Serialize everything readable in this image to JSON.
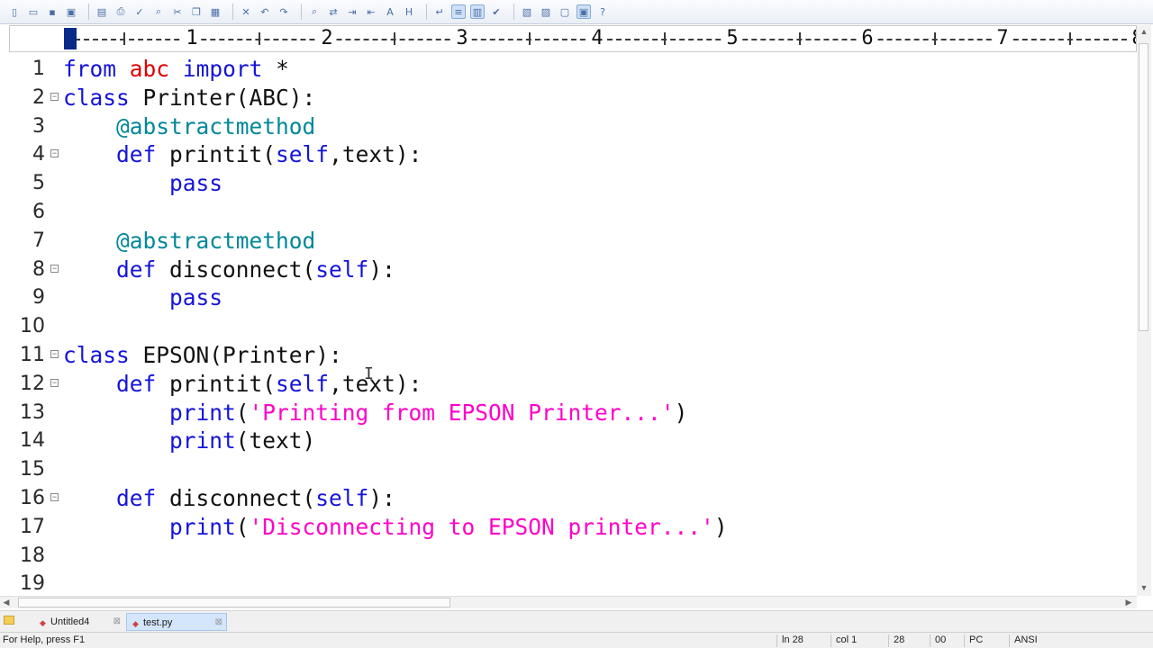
{
  "toolbar": {
    "icons": [
      "new-file-icon",
      "open-folder-icon",
      "save-icon",
      "save-all-icon",
      "print-preview-icon",
      "print-icon",
      "spell-check-icon",
      "find-icon",
      "cut-icon",
      "copy-icon",
      "paste-icon",
      "delete-icon",
      "undo-icon",
      "redo-icon",
      "search-icon",
      "replace-icon",
      "goto-icon",
      "indent-icon",
      "font-a-icon",
      "hex-icon",
      "word-wrap-icon",
      "line-number-icon",
      "code-view-icon",
      "check-icon",
      "panel-left-icon",
      "panel-right-icon",
      "window-icon",
      "fullscreen-icon",
      "help-icon"
    ]
  },
  "ruler": {
    "numbers": [
      "1",
      "2",
      "3",
      "4",
      "5",
      "6",
      "7",
      "8"
    ]
  },
  "editor": {
    "lines": [
      {
        "num": "1",
        "fold": false,
        "indent": "",
        "tokens": [
          {
            "t": "from",
            "c": "kw"
          },
          {
            "t": " "
          },
          {
            "t": "abc",
            "c": "red"
          },
          {
            "t": " "
          },
          {
            "t": "import",
            "c": "kw"
          },
          {
            "t": " *"
          }
        ]
      },
      {
        "num": "2",
        "fold": true,
        "indent": "",
        "tokens": [
          {
            "t": "class",
            "c": "kw"
          },
          {
            "t": " Printer(ABC):"
          }
        ]
      },
      {
        "num": "3",
        "fold": false,
        "indent": "    ",
        "tokens": [
          {
            "t": "@abstractmethod",
            "c": "dec"
          }
        ]
      },
      {
        "num": "4",
        "fold": true,
        "indent": "    ",
        "tokens": [
          {
            "t": "def",
            "c": "kw"
          },
          {
            "t": " printit("
          },
          {
            "t": "self",
            "c": "kw"
          },
          {
            "t": ",text):"
          }
        ]
      },
      {
        "num": "5",
        "fold": false,
        "indent": "        ",
        "tokens": [
          {
            "t": "pass",
            "c": "kw"
          }
        ]
      },
      {
        "num": "6",
        "fold": false,
        "indent": "",
        "tokens": []
      },
      {
        "num": "7",
        "fold": false,
        "indent": "    ",
        "tokens": [
          {
            "t": "@abstractmethod",
            "c": "dec"
          }
        ]
      },
      {
        "num": "8",
        "fold": true,
        "indent": "    ",
        "tokens": [
          {
            "t": "def",
            "c": "kw"
          },
          {
            "t": " disconnect("
          },
          {
            "t": "self",
            "c": "kw"
          },
          {
            "t": "):"
          }
        ]
      },
      {
        "num": "9",
        "fold": false,
        "indent": "        ",
        "tokens": [
          {
            "t": "pass",
            "c": "kw"
          }
        ]
      },
      {
        "num": "10",
        "fold": false,
        "indent": "",
        "tokens": []
      },
      {
        "num": "11",
        "fold": true,
        "indent": "",
        "tokens": [
          {
            "t": "class",
            "c": "kw"
          },
          {
            "t": " EPSON(Printer):"
          }
        ]
      },
      {
        "num": "12",
        "fold": true,
        "indent": "    ",
        "tokens": [
          {
            "t": "def",
            "c": "kw"
          },
          {
            "t": " printit("
          },
          {
            "t": "self",
            "c": "kw"
          },
          {
            "t": ",text):"
          }
        ]
      },
      {
        "num": "13",
        "fold": false,
        "indent": "        ",
        "tokens": [
          {
            "t": "print",
            "c": "kw"
          },
          {
            "t": "("
          },
          {
            "t": "'Printing from EPSON Printer...'",
            "c": "str"
          },
          {
            "t": ")"
          }
        ]
      },
      {
        "num": "14",
        "fold": false,
        "indent": "        ",
        "tokens": [
          {
            "t": "print",
            "c": "kw"
          },
          {
            "t": "(text)"
          }
        ]
      },
      {
        "num": "15",
        "fold": false,
        "indent": "",
        "tokens": []
      },
      {
        "num": "16",
        "fold": true,
        "indent": "    ",
        "tokens": [
          {
            "t": "def",
            "c": "kw"
          },
          {
            "t": " disconnect("
          },
          {
            "t": "self",
            "c": "kw"
          },
          {
            "t": "):"
          }
        ]
      },
      {
        "num": "17",
        "fold": false,
        "indent": "        ",
        "tokens": [
          {
            "t": "print",
            "c": "kw"
          },
          {
            "t": "("
          },
          {
            "t": "'Disconnecting to EPSON printer...'",
            "c": "str"
          },
          {
            "t": ")"
          }
        ]
      },
      {
        "num": "18",
        "fold": false,
        "indent": "",
        "tokens": []
      },
      {
        "num": "19",
        "fold": false,
        "indent": "",
        "tokens": []
      }
    ]
  },
  "tabs": [
    {
      "label": "Untitled4",
      "active": false
    },
    {
      "label": "test.py",
      "active": true
    }
  ],
  "status": {
    "help": "For Help, press F1",
    "line": "ln 28",
    "col": "col 1",
    "num1": "28",
    "num2": "00",
    "mode": "PC",
    "encoding": "ANSI"
  },
  "colors": {
    "keyword": "#1414d9",
    "module": "#e00000",
    "decorator": "#00879a",
    "string": "#ff00c8"
  }
}
